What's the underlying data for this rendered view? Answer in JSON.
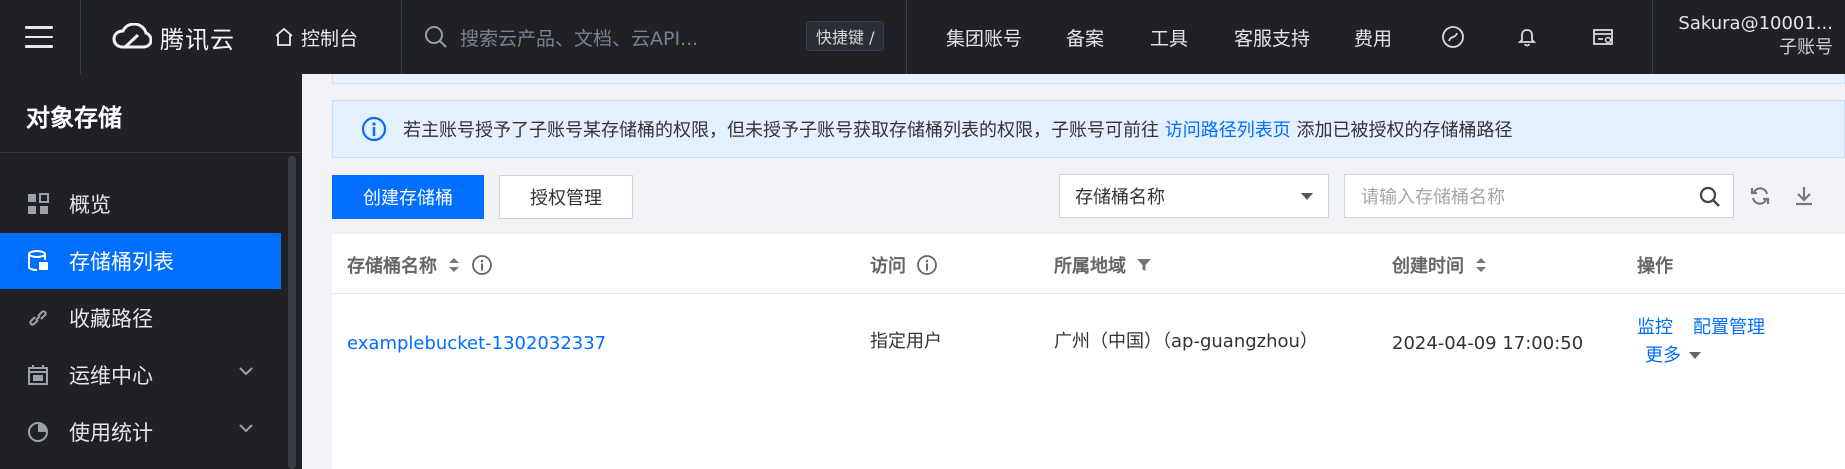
{
  "topbar": {
    "brand": "腾讯云",
    "console": "控制台",
    "search_placeholder": "搜索云产品、文档、云API...",
    "hotkey": "快捷键 /",
    "nav": [
      "集团账号",
      "备案",
      "工具",
      "客服支持",
      "费用"
    ],
    "user_name": "Sakura@10001...",
    "user_role": "子账号"
  },
  "sidebar": {
    "title": "对象存储",
    "items": [
      {
        "label": "概览",
        "icon": "dashboard-icon"
      },
      {
        "label": "存储桶列表",
        "icon": "bucket-icon",
        "active": true
      },
      {
        "label": "收藏路径",
        "icon": "link-icon"
      },
      {
        "label": "运维中心",
        "icon": "calendar-icon",
        "expandable": true
      },
      {
        "label": "使用统计",
        "icon": "pie-chart-icon",
        "expandable": true
      }
    ]
  },
  "alert": {
    "text_before": "若主账号授予了子账号某存储桶的权限，但未授予子账号获取存储桶列表的权限，子账号可前往",
    "link": "访问路径列表页",
    "text_after": "添加已被授权的存储桶路径"
  },
  "toolbar": {
    "create_button": "创建存储桶",
    "auth_button": "授权管理",
    "filter_select": "存储桶名称",
    "search_placeholder": "请输入存储桶名称"
  },
  "table": {
    "headers": [
      "存储桶名称",
      "访问",
      "所属地域",
      "创建时间",
      "操作"
    ],
    "rows": [
      {
        "name": "examplebucket-1302032337",
        "access": "指定用户",
        "region": "广州（中国）（ap-guangzhou）",
        "created": "2024-04-09 17:00:50",
        "actions": [
          "监控",
          "配置管理",
          "更多"
        ]
      }
    ]
  },
  "colors": {
    "primary": "#006eff",
    "topbar_bg": "#1f2127",
    "alert_bg": "#e5f0ff"
  }
}
